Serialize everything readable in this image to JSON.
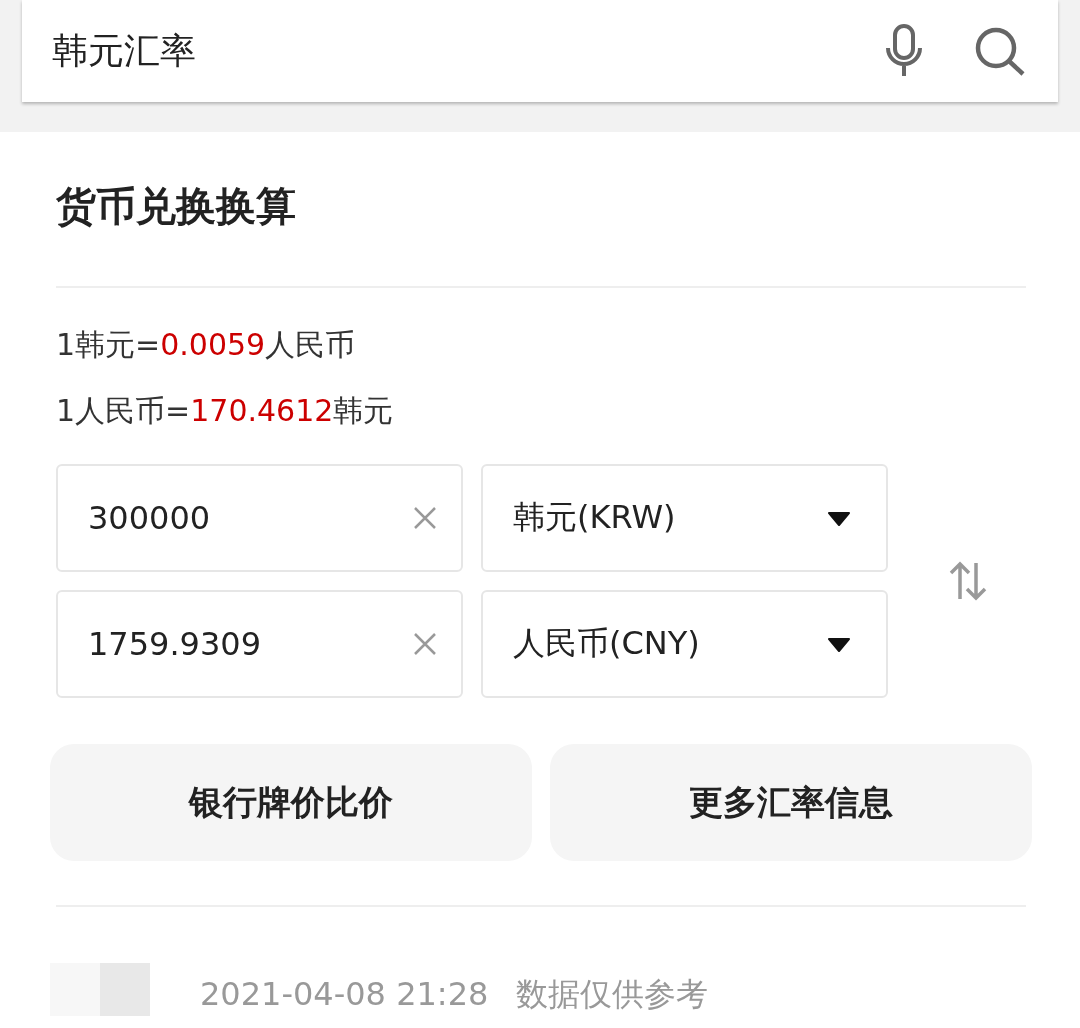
{
  "search": {
    "value": "韩元汇率"
  },
  "converter": {
    "title": "货币兑换换算",
    "rates": [
      {
        "prefix": "1韩元=",
        "value": "0.0059",
        "suffix": "人民币"
      },
      {
        "prefix": "1人民币=",
        "value": "170.4612",
        "suffix": "韩元"
      }
    ],
    "rows": [
      {
        "amount": "300000",
        "currency": "韩元(KRW)"
      },
      {
        "amount": "1759.9309",
        "currency": "人民币(CNY)"
      }
    ],
    "buttons": [
      "银行牌价比价",
      "更多汇率信息"
    ]
  },
  "footer": {
    "timestamp": "2021-04-08 21:28",
    "note": "数据仅供参考"
  }
}
